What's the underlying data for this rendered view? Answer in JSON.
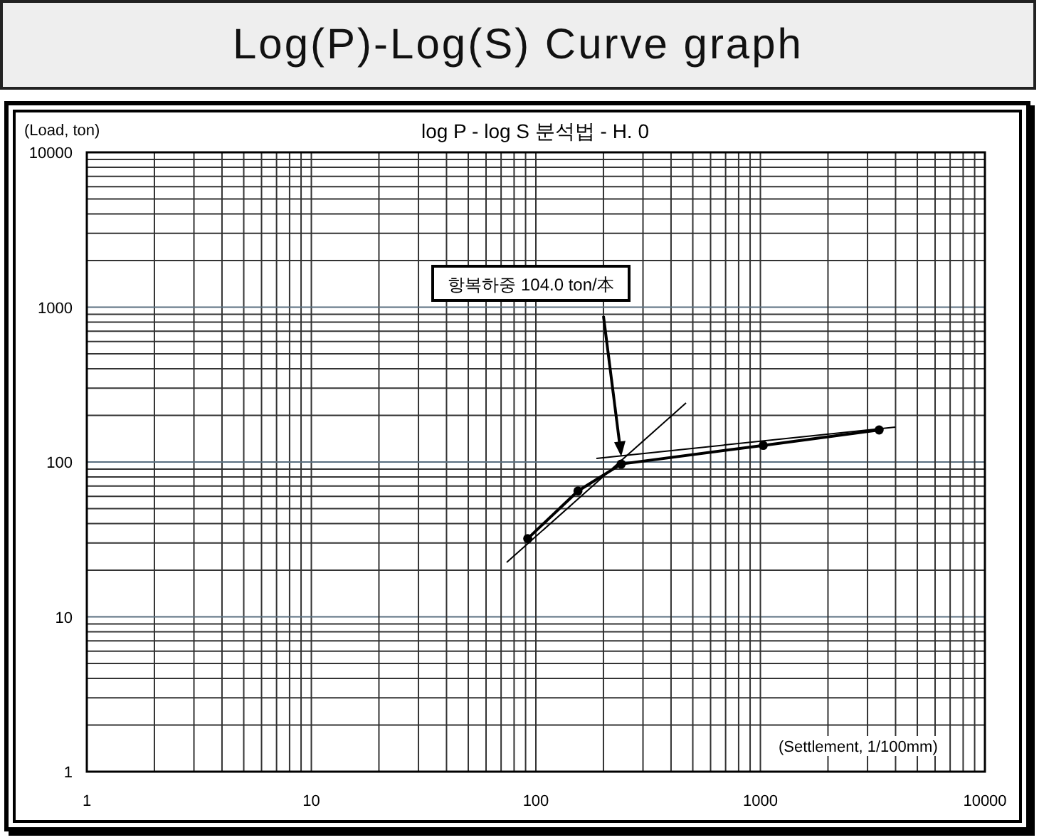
{
  "header": {
    "title": "Log(P)-Log(S) Curve graph"
  },
  "chart": {
    "title": "log P - log S 분석법 - H. 0",
    "y_axis_label": "(Load, ton)",
    "x_axis_label": "(Settlement, 1/100mm)",
    "y_tick_labels": [
      "10000",
      "1000",
      "100",
      "10",
      "1"
    ],
    "x_tick_labels": [
      "1",
      "10",
      "100",
      "1000",
      "10000"
    ],
    "callout": "항복하중 104.0 ton/本"
  }
}
